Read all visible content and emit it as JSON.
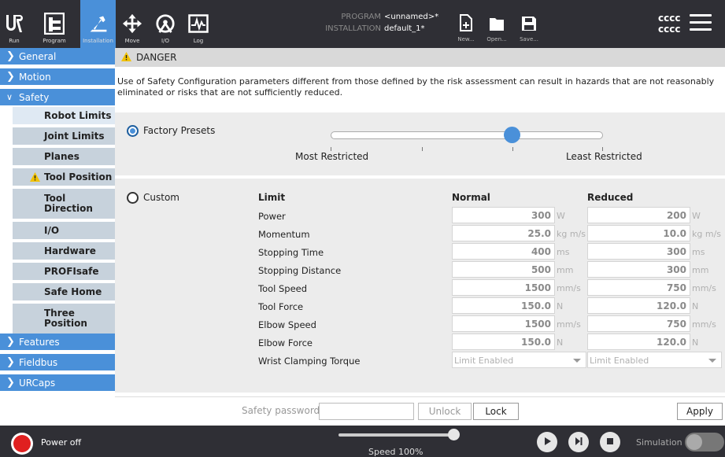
{
  "topbar": {
    "nav": [
      {
        "label": "Run",
        "icon": "ur-logo-icon"
      },
      {
        "label": "Program",
        "icon": "program-icon"
      },
      {
        "label": "Installation",
        "icon": "installation-icon"
      },
      {
        "label": "Move",
        "icon": "move-icon"
      },
      {
        "label": "I/O",
        "icon": "io-icon"
      },
      {
        "label": "Log",
        "icon": "log-icon"
      }
    ],
    "program_key": "PROGRAM",
    "program_value": "<unnamed>*",
    "installation_key": "INSTALLATION",
    "installation_value": "default_1*",
    "file_buttons": [
      {
        "label": "New...",
        "icon": "new-file-icon"
      },
      {
        "label": "Open...",
        "icon": "open-folder-icon"
      },
      {
        "label": "Save...",
        "icon": "save-icon"
      }
    ],
    "user_line1": "cccc",
    "user_line2": "cccc"
  },
  "sidebar": {
    "main_items": [
      {
        "label": "General"
      },
      {
        "label": "Motion"
      },
      {
        "label": "Safety"
      },
      {
        "label": "Features"
      },
      {
        "label": "Fieldbus"
      },
      {
        "label": "URCaps"
      }
    ],
    "safety_items": [
      {
        "label": "Robot Limits"
      },
      {
        "label": "Joint Limits"
      },
      {
        "label": "Planes"
      },
      {
        "label": "Tool Position"
      },
      {
        "label": "Tool\nDirection"
      },
      {
        "label": "I/O"
      },
      {
        "label": "Hardware"
      },
      {
        "label": "PROFIsafe"
      },
      {
        "label": "Safe Home"
      },
      {
        "label": "Three\nPosition"
      }
    ]
  },
  "danger": {
    "title": "DANGER",
    "text": "Use of Safety Configuration parameters different from those defined by the risk assessment can result in hazards that are not reasonably eliminated or risks that are not sufficiently reduced."
  },
  "presets": {
    "label": "Factory Presets",
    "selected": true,
    "slider_level": 0.67,
    "min_label": "Most Restricted",
    "max_label": "Least Restricted"
  },
  "custom": {
    "label": "Custom",
    "selected": false,
    "col_limit": "Limit",
    "col_normal": "Normal",
    "col_reduced": "Reduced",
    "rows": [
      {
        "name": "Power",
        "normal": "300",
        "reduced": "200",
        "unit": "W"
      },
      {
        "name": "Momentum",
        "normal": "25.0",
        "reduced": "10.0",
        "unit": "kg m/s"
      },
      {
        "name": "Stopping Time",
        "normal": "400",
        "reduced": "300",
        "unit": "ms"
      },
      {
        "name": "Stopping Distance",
        "normal": "500",
        "reduced": "300",
        "unit": "mm"
      },
      {
        "name": "Tool Speed",
        "normal": "1500",
        "reduced": "750",
        "unit": "mm/s"
      },
      {
        "name": "Tool Force",
        "normal": "150.0",
        "reduced": "120.0",
        "unit": "N"
      },
      {
        "name": "Elbow Speed",
        "normal": "1500",
        "reduced": "750",
        "unit": "mm/s"
      },
      {
        "name": "Elbow Force",
        "normal": "150.0",
        "reduced": "120.0",
        "unit": "N"
      }
    ],
    "wrist_label": "Wrist Clamping Torque",
    "wrist_normal": "Limit Enabled",
    "wrist_reduced": "Limit Enabled"
  },
  "password": {
    "label": "Safety password",
    "value": "",
    "unlock": "Unlock",
    "lock": "Lock",
    "apply": "Apply"
  },
  "footer": {
    "power": "Power off",
    "speed": "Speed 100%",
    "speed_level": 1.0,
    "simulation": "Simulation",
    "simulation_on": false
  }
}
